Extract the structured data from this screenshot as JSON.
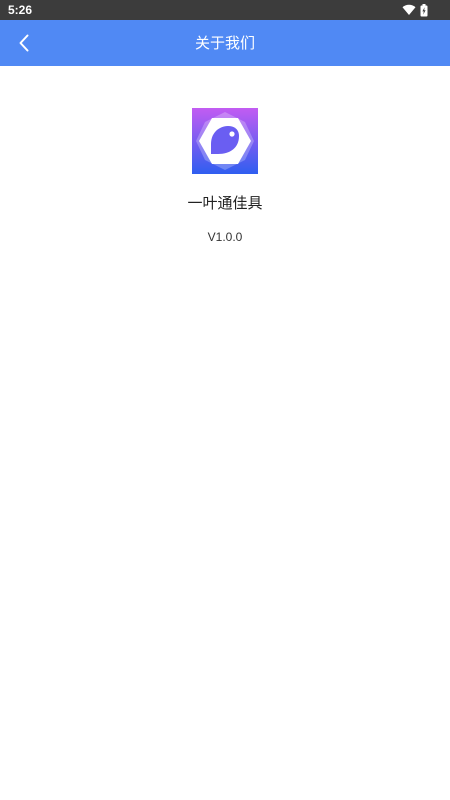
{
  "status_bar": {
    "time": "5:26",
    "icons": [
      "wifi-icon",
      "battery-icon"
    ]
  },
  "app_bar": {
    "title": "关于我们",
    "back_icon": "chevron-left-icon",
    "background": "#5089f4"
  },
  "about": {
    "app_name": "一叶通佳具",
    "version": "V1.0.0",
    "logo_icon": "app-logo-icon",
    "logo_gradient": [
      "#c25cf2",
      "#2f5ef0"
    ]
  }
}
